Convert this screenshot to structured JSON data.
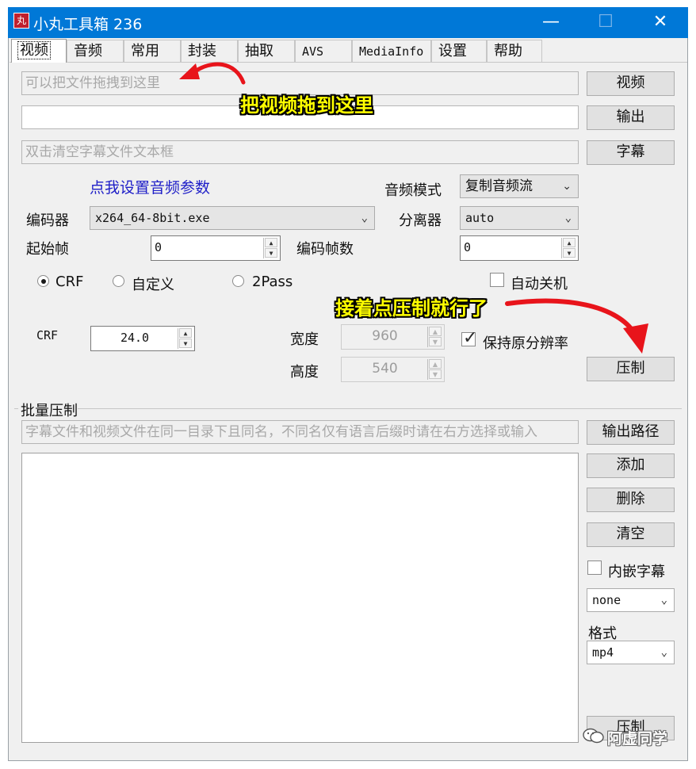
{
  "window": {
    "title": "小丸工具箱 236",
    "app_icon": "丸",
    "icons": [
      "minimize-icon",
      "maximize-icon",
      "close-icon"
    ]
  },
  "tabs": [
    "视频",
    "音频",
    "常用",
    "封装",
    "抽取",
    "AVS",
    "MediaInfo",
    "设置",
    "帮助"
  ],
  "video": {
    "file_placeholder": "可以把文件拖拽到这里",
    "output_value": "",
    "subtitle_placeholder": "双击清空字幕文件文本框",
    "video_button": "视频",
    "output_button": "输出",
    "subtitle_button": "字幕",
    "audio_settings_link": "点我设置音频参数",
    "audio_mode_label": "音频模式",
    "audio_mode_value": "复制音频流",
    "encoder_label": "编码器",
    "encoder_value": "x264_64-8bit.exe",
    "demuxer_label": "分离器",
    "demuxer_value": "auto",
    "start_frame_label": "起始帧",
    "start_frame_value": "0",
    "encode_frames_label": "编码帧数",
    "encode_frames_value": "0",
    "mode_crf": "CRF",
    "mode_custom": "自定义",
    "mode_2pass": "2Pass",
    "auto_shutdown_label": "自动关机",
    "crf_label": "CRF",
    "crf_value": "24.0",
    "width_label": "宽度",
    "width_value": "960",
    "height_label": "高度",
    "height_value": "540",
    "keep_resolution_label": "保持原分辨率",
    "compress_button": "压制"
  },
  "batch": {
    "group_title": "批量压制",
    "hint": "字幕文件和视频文件在同一目录下且同名，不同名仅有语言后缀时请在右方选择或输入",
    "output_path_button": "输出路径",
    "add_button": "添加",
    "delete_button": "删除",
    "clear_button": "清空",
    "embed_subtitle_label": "内嵌字幕",
    "subtitle_lang_value": "none",
    "format_label": "格式",
    "format_value": "mp4",
    "compress_button": "压制"
  },
  "annotations": {
    "drag_hint": "把视频拖到这里",
    "next_hint": "接着点压制就行了"
  },
  "watermark": "阿虚同学",
  "colors": {
    "titlebar": "#0078d7",
    "annotation_text": "#ffff00",
    "arrow": "#e8141b",
    "link": "#2020c8"
  }
}
